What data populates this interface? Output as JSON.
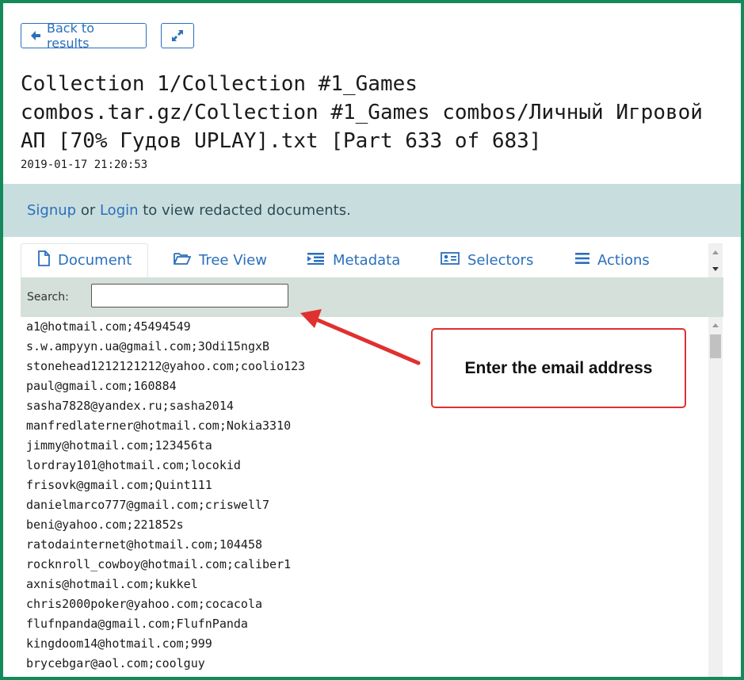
{
  "toolbar": {
    "back_label": "Back to results",
    "back_icon": "arrow-left-icon",
    "expand_icon": "expand-icon"
  },
  "document": {
    "title": "Collection 1/Collection #1_Games combos.tar.gz/Collection #1_Games combos/Личный Игровой АП [70% Гудов UPLAY].txt [Part 633 of 683]",
    "timestamp": "2019-01-17 21:20:53"
  },
  "banner": {
    "signup": "Signup",
    "or": " or ",
    "login": "Login",
    "rest": " to view redacted documents."
  },
  "tabs": [
    {
      "label": "Document",
      "icon": "file-icon",
      "active": true
    },
    {
      "label": "Tree View",
      "icon": "folder-open-icon"
    },
    {
      "label": "Metadata",
      "icon": "list-indent-icon"
    },
    {
      "label": "Selectors",
      "icon": "id-card-icon"
    },
    {
      "label": "Actions",
      "icon": "menu-icon"
    }
  ],
  "search": {
    "label": "Search:",
    "value": ""
  },
  "lines": [
    "a1@hotmail.com;45494549",
    "s.w.ampyyn.ua@gmail.com;3Odi15ngxB",
    "stonehead1212121212@yahoo.com;coolio123",
    "paul@gmail.com;160884",
    "sasha7828@yandex.ru;sasha2014",
    "manfredlaterner@hotmail.com;Nokia3310",
    "jimmy@hotmail.com;123456ta",
    "lordray101@hotmail.com;locokid",
    "frisovk@gmail.com;Quint111",
    "danielmarco777@gmail.com;criswell7",
    "beni@yahoo.com;221852s",
    "ratodainternet@hotmail.com;104458",
    "rocknroll_cowboy@hotmail.com;caliber1",
    "axnis@hotmail.com;kukkel",
    "chris2000poker@yahoo.com;cocacola",
    "flufnpanda@gmail.com;FlufnPanda",
    "kingdoom14@hotmail.com;999",
    "brycebgar@aol.com;coolguy"
  ],
  "annotation": {
    "callout_text": "Enter the email address"
  },
  "colors": {
    "frame": "#148a5a",
    "link": "#2a6fbb",
    "banner_bg": "#c8dede",
    "search_bg": "#d4e0d9",
    "annotation": "#e03030"
  }
}
